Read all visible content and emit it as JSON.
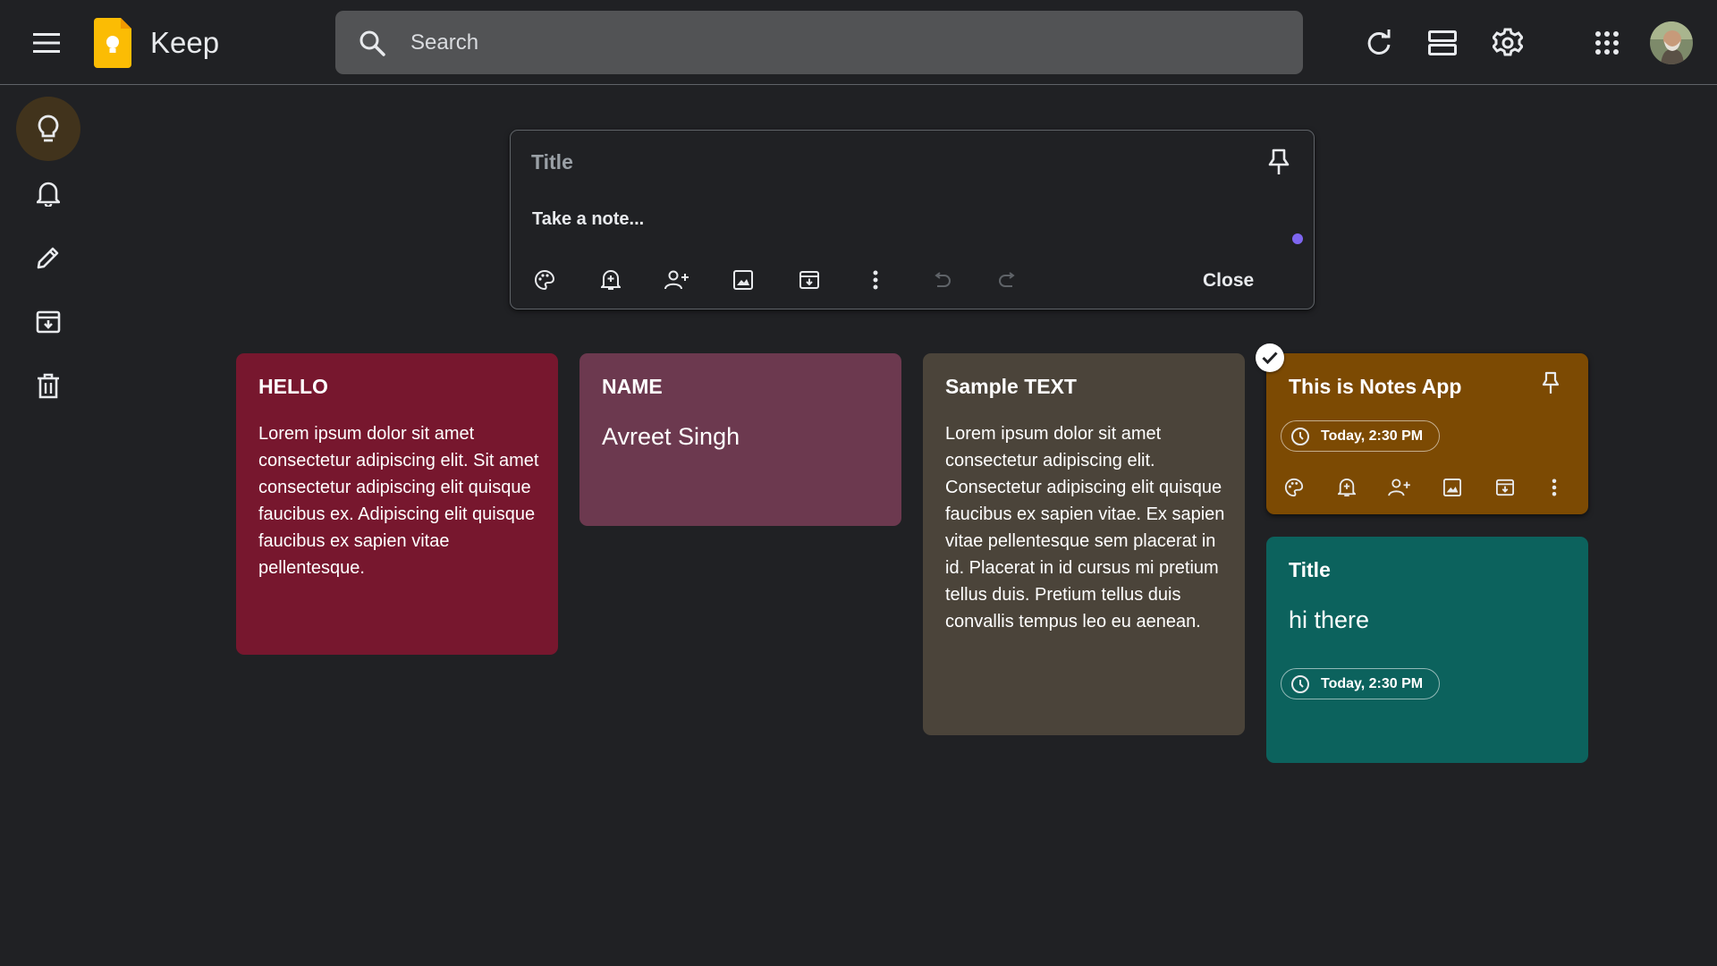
{
  "app": {
    "title": "Keep"
  },
  "search": {
    "placeholder": "Search"
  },
  "composer": {
    "title_placeholder": "Title",
    "body_placeholder": "Take a note...",
    "close_label": "Close"
  },
  "notes": [
    {
      "title": "HELLO",
      "body": "Lorem ipsum dolor sit amet consectetur adipiscing elit. Sit amet consectetur adipiscing elit quisque faucibus ex. Adipiscing elit quisque faucibus ex sapien vitae pellentesque.",
      "color": "#77172e"
    },
    {
      "title": "NAME",
      "body": "Avreet Singh",
      "color": "#6c394f"
    },
    {
      "title": "Sample TEXT",
      "body": "Lorem ipsum dolor sit amet consectetur adipiscing elit. Consectetur adipiscing elit quisque faucibus ex sapien vitae. Ex sapien vitae pellentesque sem placerat in id. Placerat in id cursus mi pretium tellus duis. Pretium tellus duis convallis tempus leo eu aenean.",
      "color": "#4b443a"
    },
    {
      "title": "This is Notes App",
      "reminder": "Today, 2:30 PM",
      "color": "#7c4a03",
      "selected": true
    },
    {
      "title": "Title",
      "body": "hi there",
      "reminder": "Today, 2:30 PM",
      "color": "#0c625d"
    }
  ],
  "colors": {
    "background": "#202124",
    "search_bg": "#525355",
    "sidebar_active": "#41331c",
    "accent_dot": "#7e66f0",
    "logo_yellow": "#fbbc04"
  },
  "icons": {
    "header": [
      "menu-icon",
      "search-icon",
      "refresh-icon",
      "list-view-icon",
      "settings-icon",
      "apps-grid-icon"
    ],
    "sidebar": [
      "lightbulb-icon",
      "bell-icon",
      "pencil-icon",
      "archive-icon",
      "trash-icon"
    ],
    "composer_tools": [
      "palette-icon",
      "remind-icon",
      "collaborator-icon",
      "image-icon",
      "archive-icon",
      "more-icon",
      "undo-icon",
      "redo-icon"
    ]
  }
}
